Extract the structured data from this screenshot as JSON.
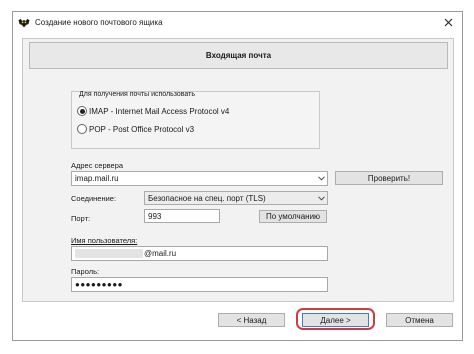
{
  "window": {
    "title": "Создание нового почтового ящика"
  },
  "page": {
    "header": "Входящая почта"
  },
  "protocol": {
    "legend": "Для получения почты использовать",
    "options": [
      {
        "label": "IMAP - Internet Mail Access Protocol v4",
        "selected": true
      },
      {
        "label": "POP  -  Post Office Protocol v3",
        "selected": false
      }
    ]
  },
  "form": {
    "server": {
      "label": "Адрес сервера",
      "value": "imap.mail.ru"
    },
    "check_button": "Проверить!",
    "connection": {
      "label": "Соединение:",
      "value": "Безопасное на спец. порт (TLS)"
    },
    "port": {
      "label": "Порт:",
      "value": "993"
    },
    "default_button": "По умолчанию",
    "username": {
      "label": "Имя пользователя:",
      "value_suffix": "@mail.ru"
    },
    "password": {
      "label": "Пароль:",
      "value": "●●●●●●●●●"
    }
  },
  "footer": {
    "back": "< Назад",
    "next": "Далее  >",
    "cancel": "Отмена"
  },
  "colors": {
    "highlight": "#d23a44",
    "default_button_border": "#3c7fd0",
    "page_bg": "#f2f2f2"
  },
  "icons": {
    "app": "bat-logo-icon",
    "close": "close-icon",
    "dropdown": "chevron-down-icon"
  }
}
